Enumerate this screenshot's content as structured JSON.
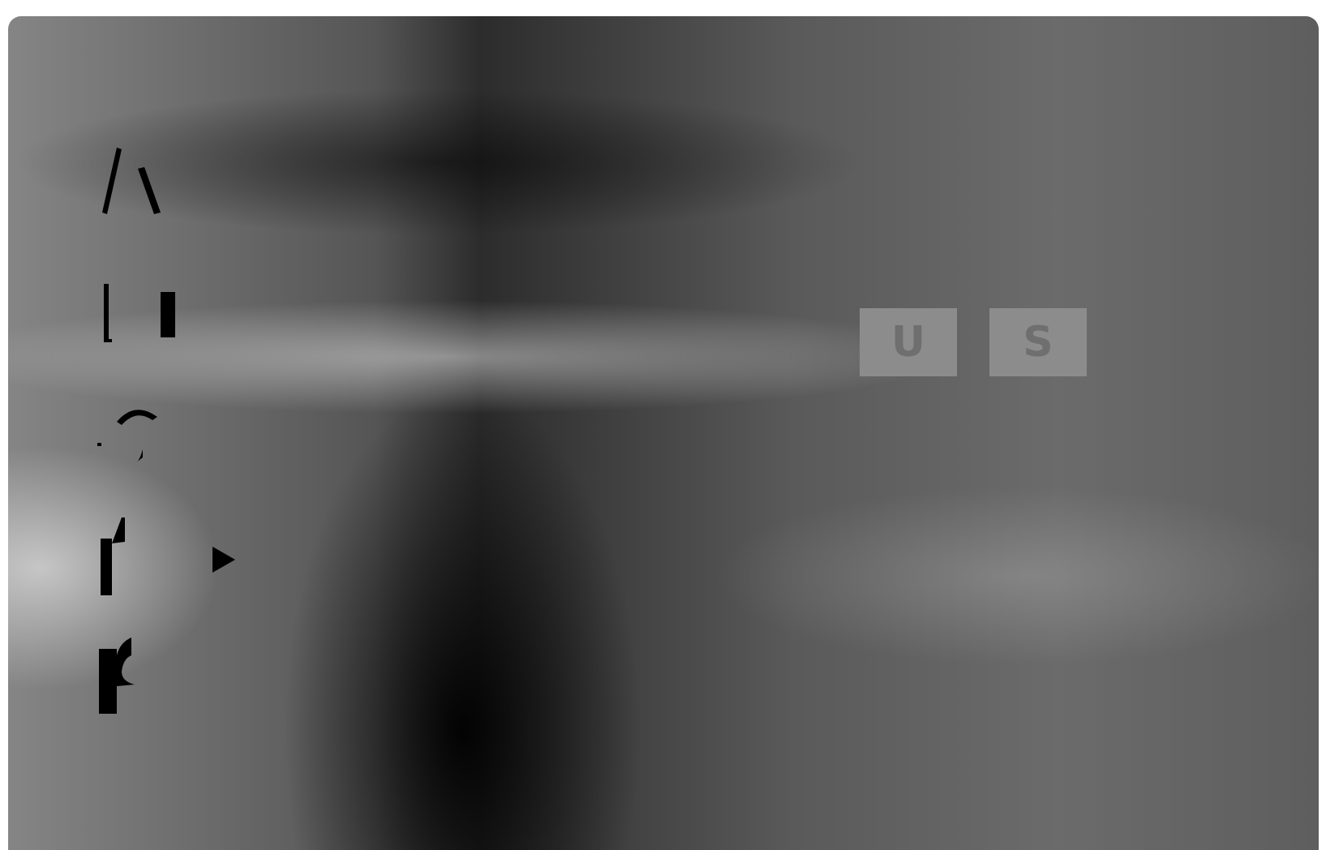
{
  "menu": {
    "items": [
      {
        "icon": "audio-icon"
      },
      {
        "icon": "subtitle-icon"
      },
      {
        "icon": "menu-icon"
      },
      {
        "icon": "rating-icon"
      },
      {
        "icon": "parental-icon"
      }
    ],
    "selected_index": 3
  },
  "options": {
    "first": "U",
    "second": "S"
  },
  "colors": {
    "option_bg": "#8c8c8c",
    "option_text": "#6f6f6f",
    "icon": "#000000"
  }
}
